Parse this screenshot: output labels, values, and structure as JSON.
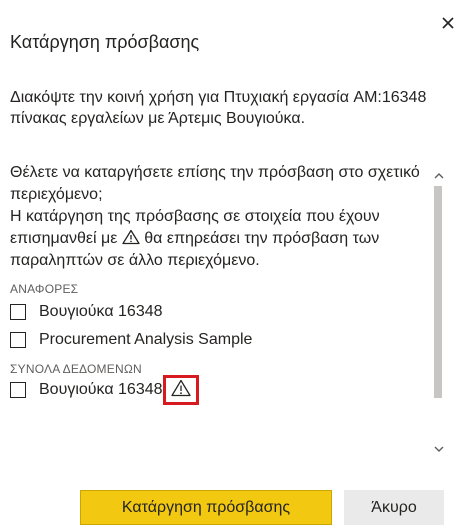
{
  "dialog": {
    "title": "Κατάργηση πρόσβασης",
    "description": "Διακόψτε την κοινή χρήση για Πτυχιακή εργασία AM:16348 πίνακας εργαλείων με Άρτεμις Βουγιούκα.",
    "question_line1": "Θέλετε να καταργήσετε επίσης την πρόσβαση στο σχετικό περιεχόμενο;",
    "question_line2_before_icon": "Η κατάργηση της πρόσβασης σε στοιχεία που έχουν επισημανθεί με ",
    "question_line2_after_icon": " θα επηρεάσει την πρόσβαση των παραληπτών σε άλλο περιεχόμενο.",
    "reports_header": "ΑΝΑΦΟΡΕΣ",
    "reports": [
      {
        "label": "Βουγιούκα 16348"
      },
      {
        "label": "Procurement Analysis Sample"
      }
    ],
    "datasets_header": "ΣΥΝΟΛΑ ΔΕΔΟΜΕΝΩΝ",
    "datasets": [
      {
        "label": "Βουγιούκα 16348"
      }
    ],
    "remove_button_label": "Κατάργηση πρόσβασης",
    "cancel_button_label": "Άκυρο"
  },
  "colors": {
    "primary_button": "#f2c811",
    "highlight_border": "#d71920",
    "text": "#252423",
    "scrollbar": "#c8c6c4"
  },
  "icons": {
    "close": "close-icon",
    "warning": "warning-icon",
    "scroll_up": "chevron-up-icon",
    "scroll_down": "chevron-down-icon"
  }
}
